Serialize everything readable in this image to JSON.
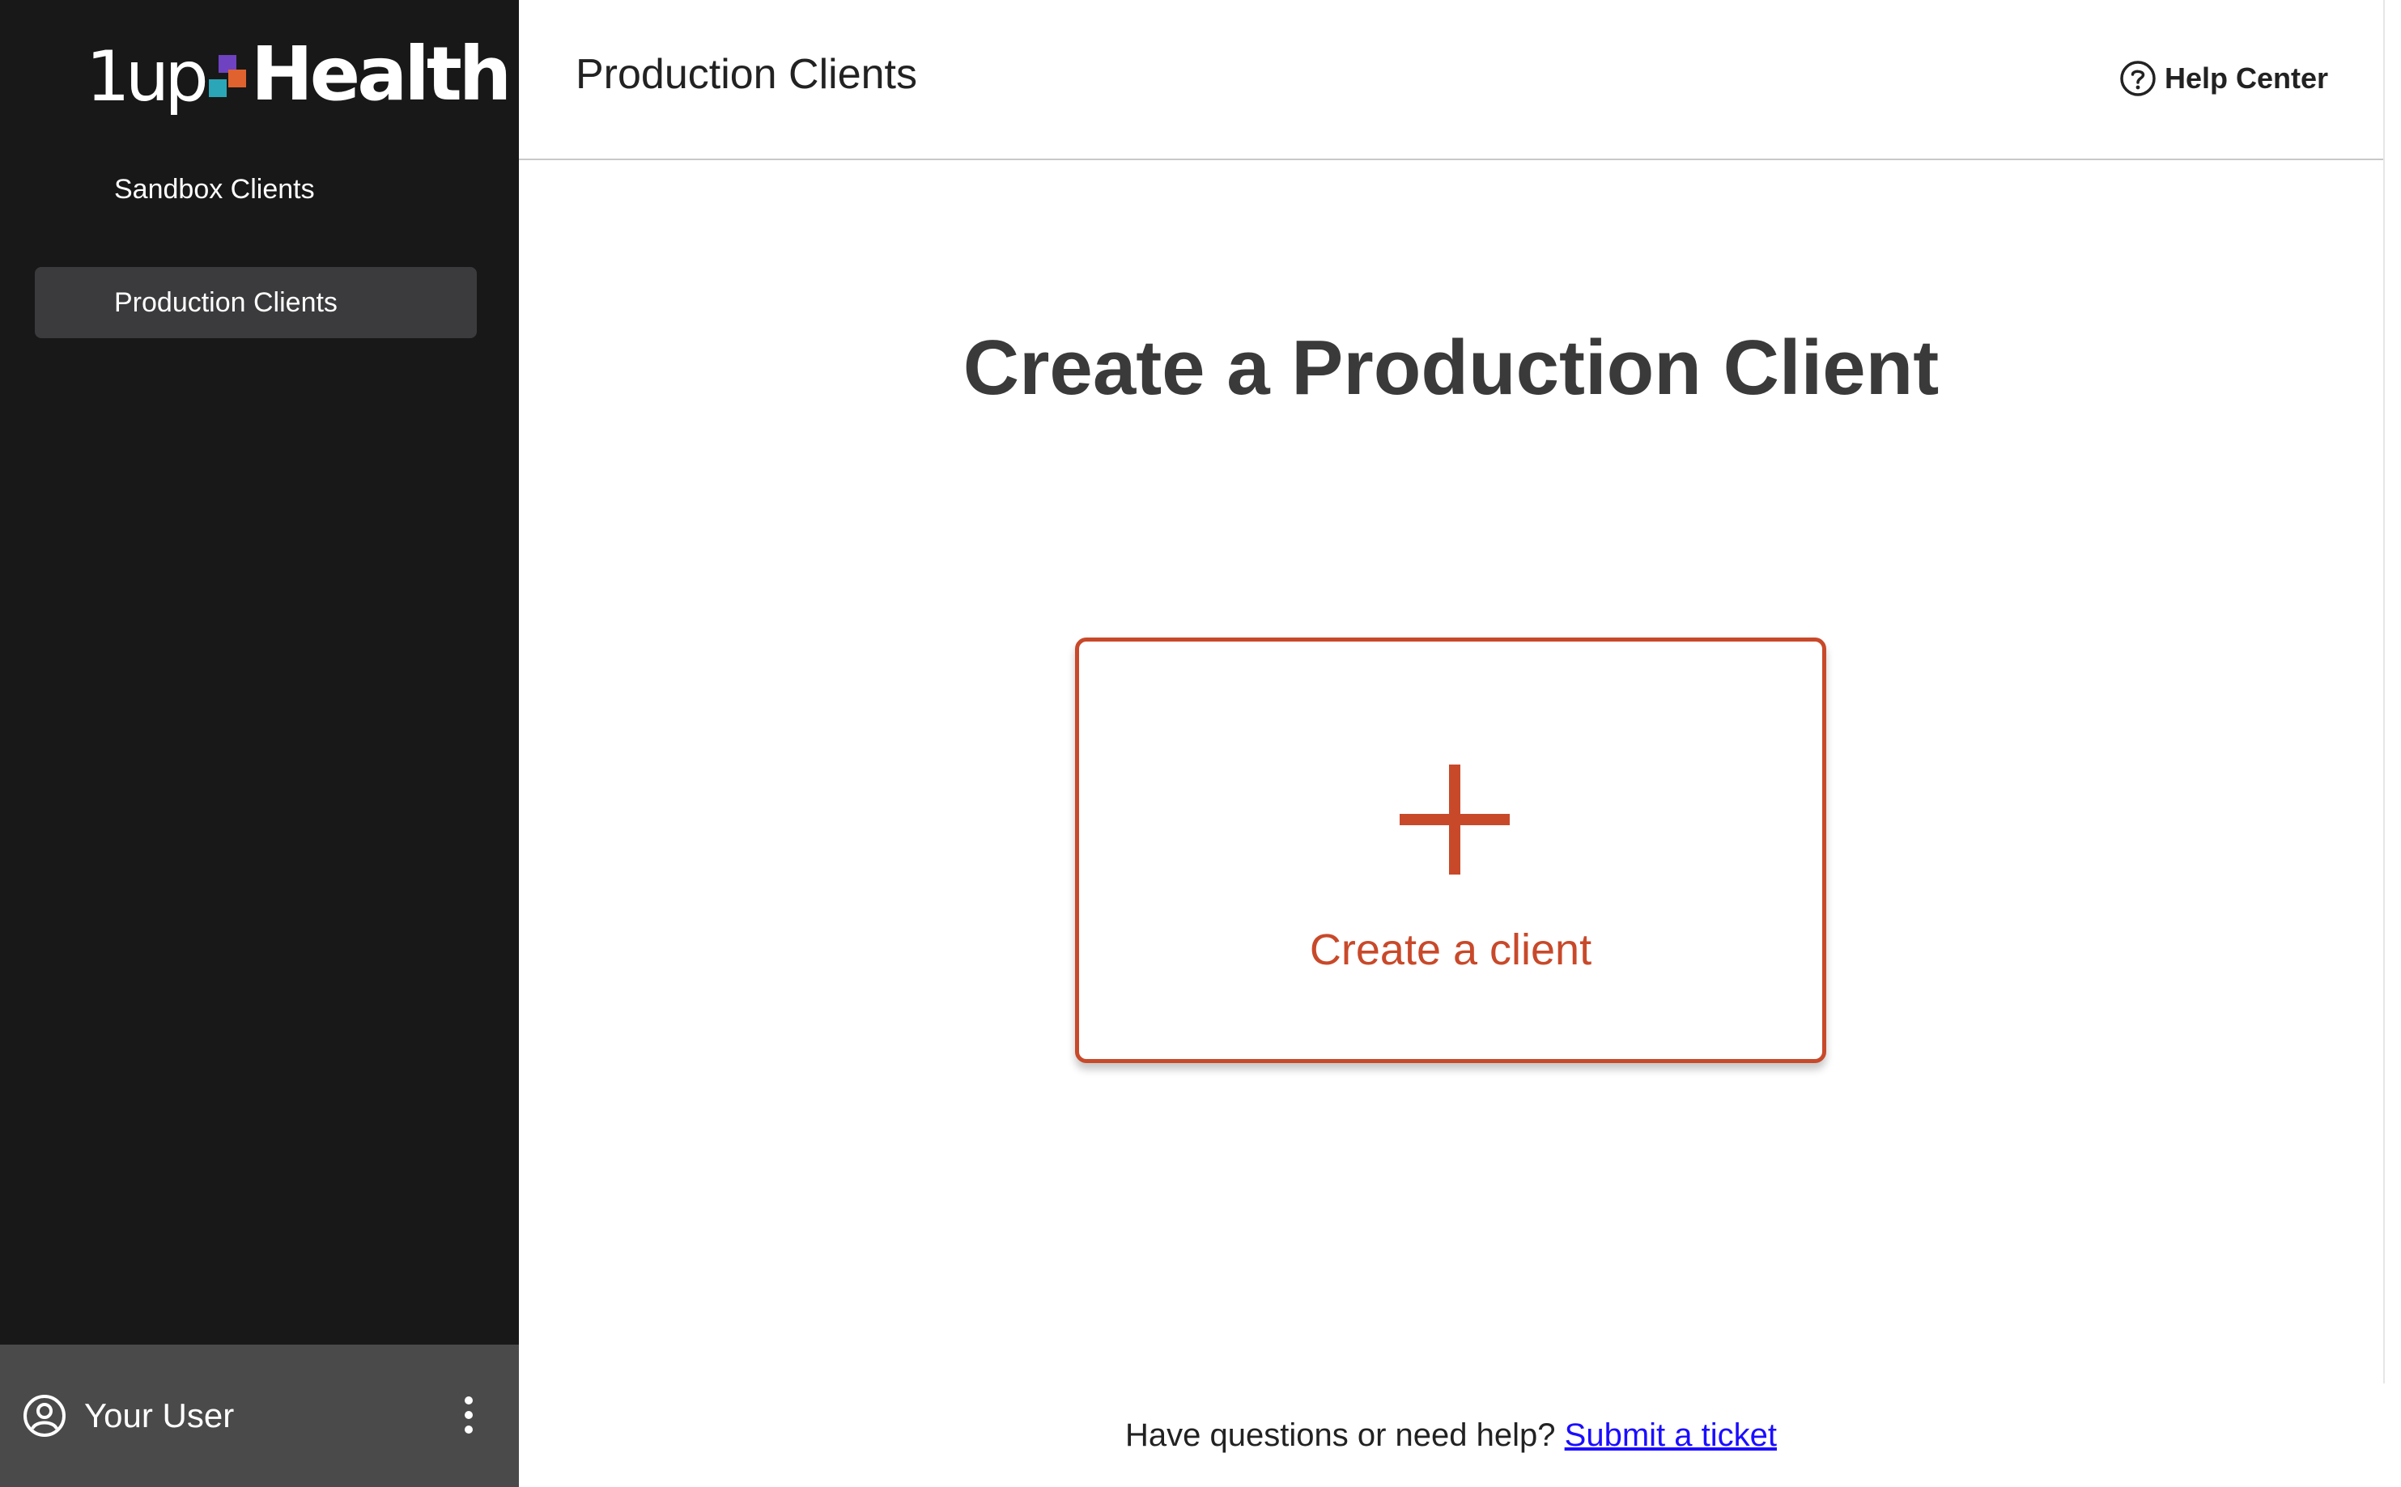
{
  "sidebar": {
    "logo_text_1": "1up",
    "logo_text_2": "Health",
    "items": [
      {
        "label": "Sandbox Clients",
        "active": false
      },
      {
        "label": "Production Clients",
        "active": true
      }
    ],
    "user": {
      "name": "Your User",
      "icon": "user-circle-icon",
      "menu_icon": "kebab-menu-icon"
    }
  },
  "header": {
    "title": "Production Clients",
    "help_label": "Help Center",
    "help_icon": "help-circle-icon"
  },
  "main": {
    "heading": "Create a Production Client",
    "create_card": {
      "label": "Create a client",
      "icon": "plus-icon"
    }
  },
  "footer": {
    "text": "Have questions or need help?",
    "link_label": "Submit a ticket"
  },
  "colors": {
    "sidebar_bg": "#181818",
    "active_item_bg": "#3b3b3d",
    "user_bar_bg": "#4a4a4a",
    "accent": "#c8492a",
    "link": "#1a0dff"
  }
}
